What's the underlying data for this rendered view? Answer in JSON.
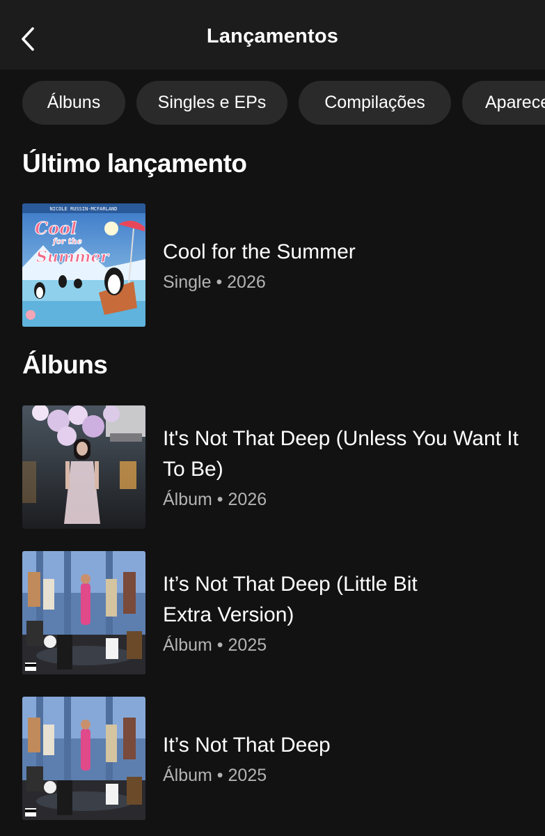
{
  "header": {
    "title": "Lançamentos",
    "back_icon": "chevron-left-icon"
  },
  "filters": [
    {
      "label": "Álbuns"
    },
    {
      "label": "Singles e EPs"
    },
    {
      "label": "Compilações"
    },
    {
      "label": "Aparece"
    }
  ],
  "latest": {
    "section_title": "Último lançamento",
    "item": {
      "title": "Cool for the Summer",
      "subtitle": "Single • 2026",
      "cover_text": {
        "artist": "NICOLE RUSSIN-MCFARLAND",
        "line1": "Cool",
        "line2": "for the",
        "line3": "Summer"
      }
    }
  },
  "albums": {
    "section_title": "Álbuns",
    "items": [
      {
        "title": "It's Not That Deep (Unless You Want It To Be)",
        "subtitle": "Álbum • 2026"
      },
      {
        "title": "It’s Not That Deep (Little Bit Extra Version)",
        "subtitle": "Álbum • 2025"
      },
      {
        "title": "It’s Not That Deep",
        "subtitle": "Álbum • 2025"
      }
    ]
  },
  "colors": {
    "background": "#121212",
    "header": "#1c1c1c",
    "chip": "#2a2a2a",
    "secondary_text": "#b3b3b3"
  }
}
